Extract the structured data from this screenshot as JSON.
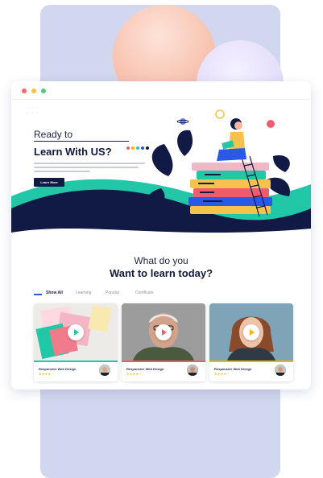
{
  "hero": {
    "ready": "Ready to",
    "learn": "Learn With US?",
    "button": "Learn More"
  },
  "section": {
    "subtitle": "What do you",
    "title": "Want to learn today?"
  },
  "tabs": [
    "Show All",
    "Learning",
    "Popular",
    "Certificate"
  ],
  "cards": [
    {
      "title": "Responsive Web Design",
      "stars": "★★★★☆",
      "accent": "#22c7a7"
    },
    {
      "title": "Responsive Web Design",
      "stars": "★★★★☆",
      "accent": "#ef5d6d"
    },
    {
      "title": "Responsive Web Design",
      "stars": "★★★★☆",
      "accent": "#f5b400"
    }
  ],
  "colors": {
    "navy": "#101a45",
    "teal": "#22c7a7",
    "accent_dots": [
      "#ef5d6d",
      "#f5b400",
      "#22c7a7",
      "#2a59e6",
      "#101a45"
    ]
  }
}
